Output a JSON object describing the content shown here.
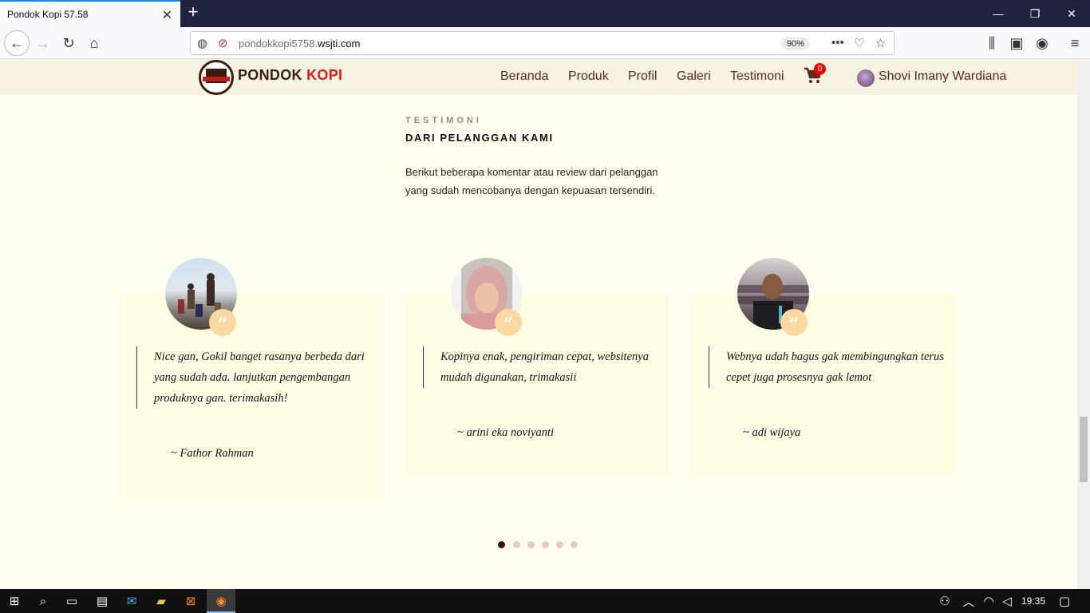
{
  "browser": {
    "tab_title": "Pondok Kopi 57.58",
    "url_prefix": "pondokkopi5758.",
    "url_domain": "wsjti.com",
    "zoom": "90%"
  },
  "site": {
    "brand_main": "PONDOK",
    "brand_accent": "KOPI",
    "menu": [
      "Beranda",
      "Produk",
      "Profil",
      "Galeri",
      "Testimoni"
    ],
    "cart_count": "0",
    "user_name": "Shovi Imany Wardiana"
  },
  "section": {
    "subtitle": "TESTIMONI",
    "title": "DARI PELANGGAN KAMI",
    "description": "Berikut beberapa komentar atau review dari pelanggan yang sudah mencobanya dengan kepuasan tersendiri."
  },
  "testimonials": [
    {
      "text": "Nice gan, Gokil banget rasanya berbeda dari yang sudah ada. lanjutkan pengembangan produknya gan. terimakasih!",
      "author": "~ Fathor Rahman"
    },
    {
      "text": "Kopinya enak, pengiriman cepat, websitenya mudah digunakan, trimakasii",
      "author": "~ arini eka noviyanti"
    },
    {
      "text": "Webnya udah bagus gak membingungkan terus cepet juga prosesnya gak lemot",
      "author": "~ adi wijaya"
    }
  ],
  "carousel": {
    "pages": 6,
    "active": 0
  },
  "taskbar": {
    "time": "19:35"
  }
}
